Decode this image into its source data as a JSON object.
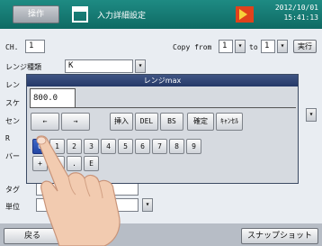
{
  "header": {
    "op_button": "操作",
    "title": "入力詳細設定",
    "date": "2012/10/01",
    "time": "15:41:13",
    "colors": {
      "bar": "#1e8b83",
      "flag": "#e0421c"
    }
  },
  "form": {
    "ch_label": "CH.",
    "ch_value": "1",
    "copy_from_label": "Copy from",
    "copy_from_value": "1",
    "to_label": "to",
    "to_value": "1",
    "exec_label": "実行",
    "range_type_label": "レンジ種類",
    "range_type_value": "K",
    "side_labels": [
      "レン",
      "スケ",
      "セン",
      "R",
      "バー"
    ],
    "tag_label": "タグ",
    "unit_label": "単位"
  },
  "keypad": {
    "title": "レンジmax",
    "display_value": "800.0",
    "row_a": [
      "←",
      "→",
      "挿入",
      "DEL",
      "BS",
      "確定",
      "ｷｬﾝｾﾙ"
    ],
    "row_b": [
      "0",
      "1",
      "2",
      "3",
      "4",
      "5",
      "6",
      "7",
      "8",
      "9"
    ],
    "row_c": [
      "+",
      "-",
      ".",
      "E"
    ],
    "selected_key": "0"
  },
  "footer": {
    "back_label": "戻る",
    "snapshot_label": "スナップショット"
  }
}
